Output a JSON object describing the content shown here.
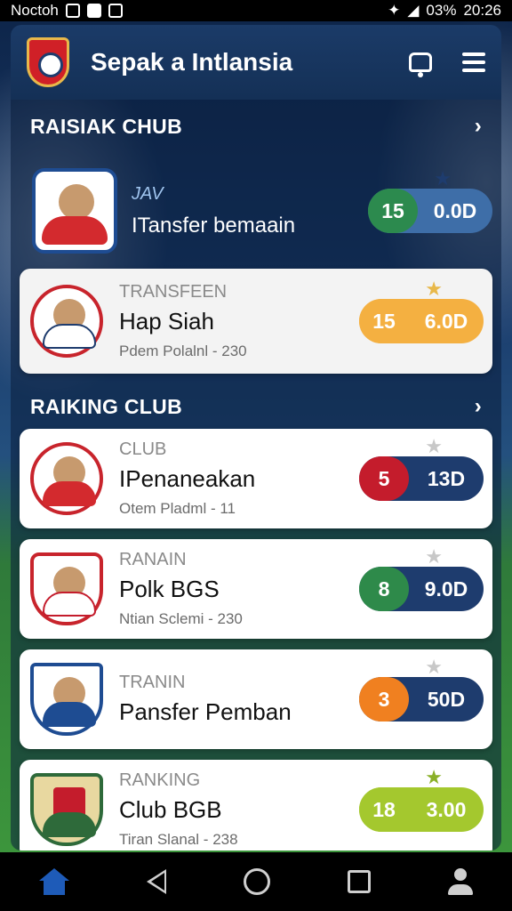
{
  "status_bar": {
    "carrier": "Noctoh",
    "battery": "03%",
    "time": "20:26"
  },
  "header": {
    "title": "Sepak a Intlansia"
  },
  "sections": {
    "top_title": "RAISIAK CHUB",
    "ranking_title": "RAIKING CLUB"
  },
  "feature": {
    "tag": "JAV",
    "name": "ITansfer bemaain",
    "score_left": "15",
    "score_right": "0.0D",
    "color_left": "#2c8a4e",
    "color_right": "#3e6ea8"
  },
  "cards": [
    {
      "category": "TRANSFEEN",
      "name": "Hap Siah",
      "sub": "Pdem Polalnl - 230",
      "score_left": "15",
      "score_right": "6.0D",
      "color_left": "#f4b041",
      "color_right": "#f4b041",
      "star_color": "#e8b84a"
    },
    {
      "category": "CLUB",
      "name": "IPenaneakan",
      "sub": "Otem Pladml - 11",
      "score_left": "5",
      "score_right": "13D",
      "color_left": "#c41c2c",
      "color_right": "#1e3c6e",
      "star_color": "#c8c8c8"
    },
    {
      "category": "RANAIN",
      "name": "Polk BGS",
      "sub": "Ntian Sclemi - 230",
      "score_left": "8",
      "score_right": "9.0D",
      "color_left": "#2e8a4a",
      "color_right": "#1e3c6e",
      "star_color": "#c8c8c8"
    },
    {
      "category": "TRANIN",
      "name": "Pansfer Pemban",
      "sub": "",
      "score_left": "3",
      "score_right": "50D",
      "color_left": "#f08020",
      "color_right": "#1e3c6e",
      "star_color": "#c8c8c8"
    },
    {
      "category": "RANKING",
      "name": "Club BGB",
      "sub": "Tiran Slanal - 238",
      "score_left": "18",
      "score_right": "3.00",
      "color_left": "#a4c82e",
      "color_right": "#a4c82e",
      "star_color": "#8ab028"
    }
  ],
  "icons": {
    "bell": "bell-icon",
    "menu": "menu-icon",
    "chevron": "chevron-right-icon",
    "star": "star-icon"
  },
  "chevron_glyph": "›",
  "star_glyph": "★"
}
